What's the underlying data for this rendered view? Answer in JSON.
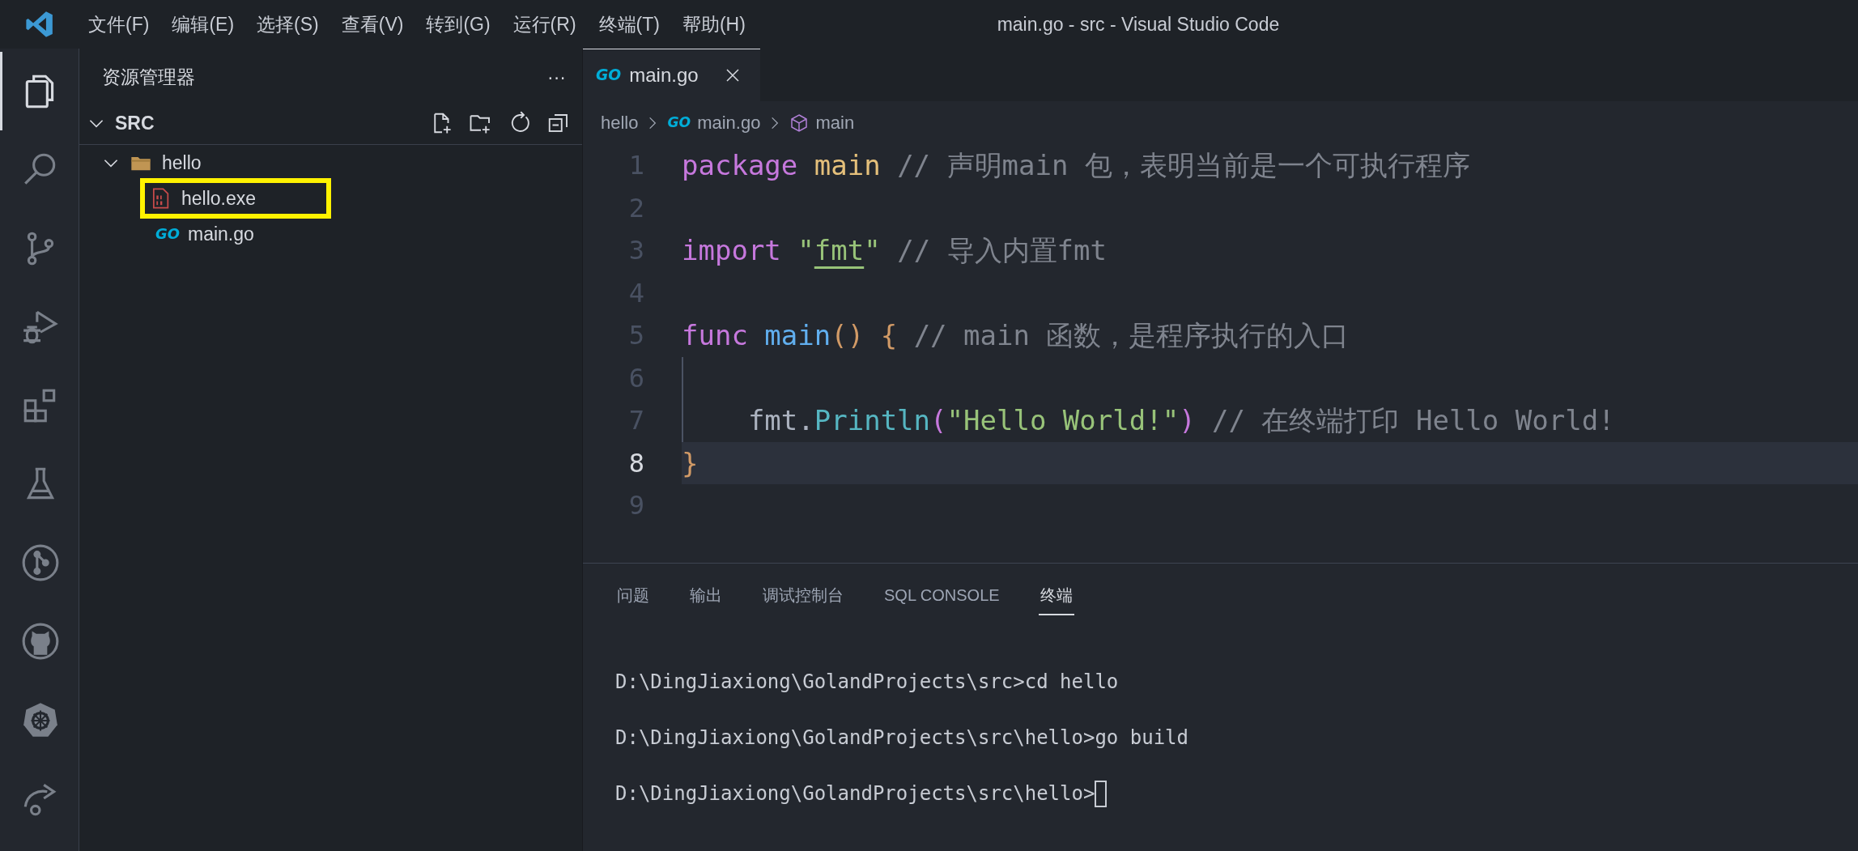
{
  "window": {
    "title": "main.go - src - Visual Studio Code"
  },
  "menu": [
    "文件(F)",
    "编辑(E)",
    "选择(S)",
    "查看(V)",
    "转到(G)",
    "运行(R)",
    "终端(T)",
    "帮助(H)"
  ],
  "activity_bar": [
    {
      "kind": "files",
      "selected": true
    },
    {
      "kind": "search",
      "selected": false
    },
    {
      "kind": "source-control",
      "selected": false
    },
    {
      "kind": "run-debug",
      "selected": false
    },
    {
      "kind": "extensions",
      "selected": false
    },
    {
      "kind": "testing",
      "selected": false
    },
    {
      "kind": "git-graph",
      "selected": false
    },
    {
      "kind": "github",
      "selected": false
    },
    {
      "kind": "kubernetes",
      "selected": false
    },
    {
      "kind": "remote",
      "selected": false
    }
  ],
  "sidebar": {
    "title": "资源管理器",
    "more": "···",
    "root": {
      "label": "SRC",
      "expanded": true
    },
    "tree": [
      {
        "label": "hello",
        "kind": "folder",
        "expanded": true,
        "children": [
          {
            "label": "hello.exe",
            "kind": "binary",
            "annotated": true
          },
          {
            "label": "main.go",
            "kind": "go",
            "icon_text": "GO",
            "annotated": false
          }
        ]
      }
    ]
  },
  "editor": {
    "tabs": [
      {
        "label": "main.go",
        "icon_text": "GO",
        "selected": true
      }
    ],
    "breadcrumbs": [
      {
        "label": "hello",
        "kind": "folder"
      },
      {
        "label": "main.go",
        "kind": "go",
        "icon_text": "GO"
      },
      {
        "label": "main",
        "kind": "symbol"
      }
    ],
    "lines": [
      {
        "number": "1",
        "current": false,
        "guide": false,
        "tokens": [
          {
            "text": "package ",
            "kind": "keyword"
          },
          {
            "text": "main ",
            "kind": "package"
          },
          {
            "text": "// 声明main 包，表明当前是一个可执行程序",
            "kind": "comment"
          }
        ]
      },
      {
        "number": "2",
        "current": false,
        "guide": false
      },
      {
        "number": "3",
        "current": false,
        "guide": false,
        "tokens": [
          {
            "text": "import ",
            "kind": "keyword"
          },
          {
            "text": "\"",
            "kind": "string"
          },
          {
            "text": "fmt",
            "kind": "link"
          },
          {
            "text": "\" ",
            "kind": "string"
          },
          {
            "text": "// 导入内置fmt",
            "kind": "comment"
          }
        ]
      },
      {
        "number": "4",
        "current": false,
        "guide": false
      },
      {
        "number": "5",
        "current": false,
        "guide": false,
        "tokens": [
          {
            "text": "func ",
            "kind": "keyword"
          },
          {
            "text": "main",
            "kind": "function"
          },
          {
            "text": "() ",
            "kind": "bracket1"
          },
          {
            "text": "{ ",
            "kind": "bracket1"
          },
          {
            "text": "// main 函数，是程序执行的入口",
            "kind": "comment"
          }
        ]
      },
      {
        "number": "6",
        "current": false,
        "guide": true
      },
      {
        "number": "7",
        "current": false,
        "guide": true,
        "tokens": [
          {
            "text": "    fmt."
          },
          {
            "text": "Println",
            "kind": "method"
          },
          {
            "text": "(",
            "kind": "bracket2"
          },
          {
            "text": "\"Hello World!\"",
            "kind": "string"
          },
          {
            "text": ") ",
            "kind": "bracket2"
          },
          {
            "text": "// 在终端打印 Hello World!",
            "kind": "comment"
          }
        ]
      },
      {
        "number": "8",
        "current": true,
        "guide": false,
        "tokens": [
          {
            "text": "}",
            "kind": "bracket1"
          }
        ]
      },
      {
        "number": "9",
        "current": false,
        "guide": false
      }
    ]
  },
  "panel": {
    "tabs": [
      {
        "label": "问题",
        "selected": false
      },
      {
        "label": "输出",
        "selected": false
      },
      {
        "label": "调试控制台",
        "selected": false
      },
      {
        "label": "SQL CONSOLE",
        "selected": false
      },
      {
        "label": "终端",
        "selected": true
      }
    ],
    "terminal": [
      {
        "text": "D:\\DingJiaxiong\\GolandProjects\\src>cd hello",
        "cursor": false
      },
      {
        "text": "D:\\DingJiaxiong\\GolandProjects\\src\\hello>go build",
        "cursor": false
      },
      {
        "text": "D:\\DingJiaxiong\\GolandProjects\\src\\hello>",
        "cursor": true
      }
    ]
  }
}
